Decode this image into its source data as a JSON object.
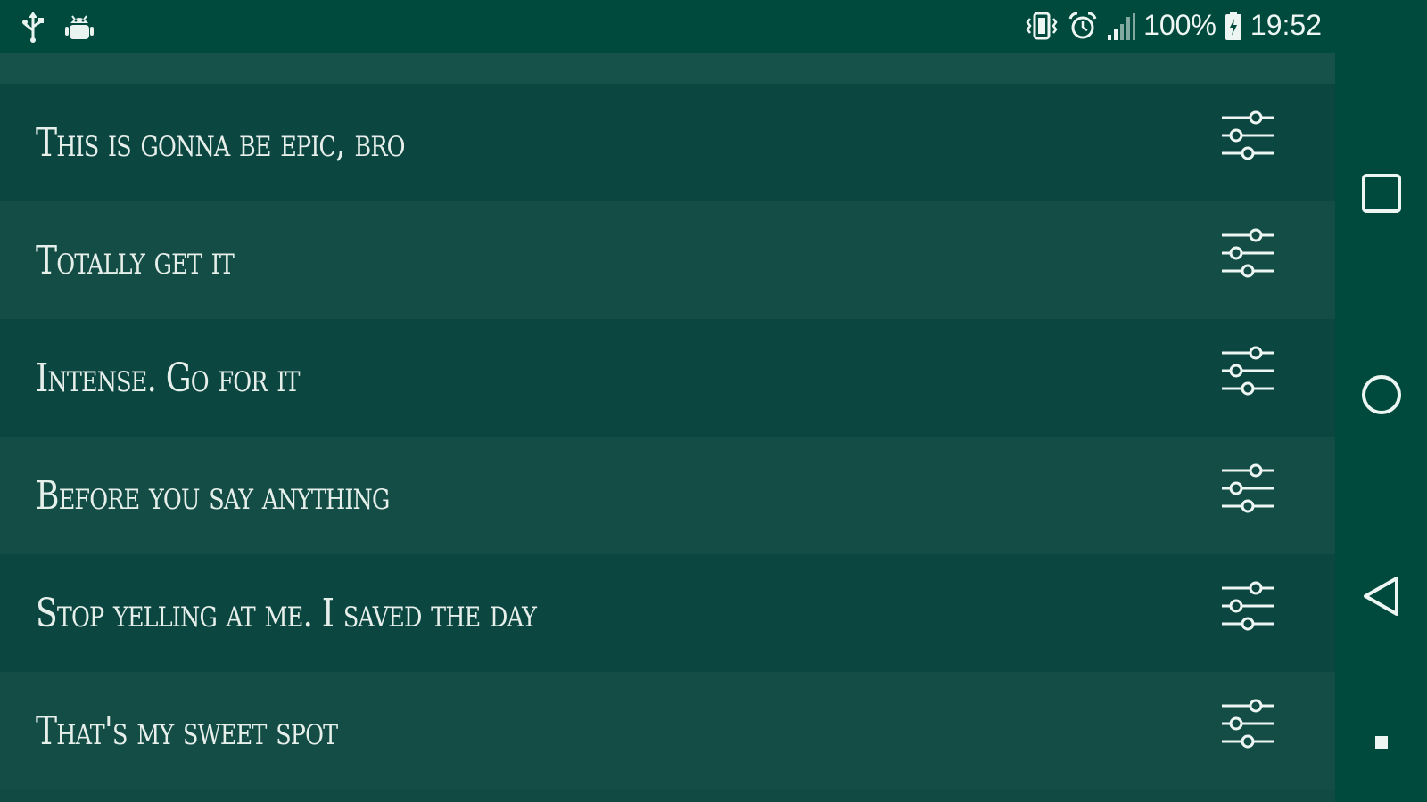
{
  "status_bar": {
    "battery_percent": "100%",
    "time": "19:52",
    "left_icons": [
      "usb-icon",
      "android-debug-icon"
    ],
    "right_icons": [
      "vibrate-icon",
      "alarm-icon",
      "signal-icon",
      "battery-icon"
    ]
  },
  "list": {
    "items": [
      {
        "label": "This is gonna be epic, bro",
        "action_icon": "sliders-icon"
      },
      {
        "label": "Totally get it",
        "action_icon": "sliders-icon"
      },
      {
        "label": "Intense. Go for it",
        "action_icon": "sliders-icon"
      },
      {
        "label": "Before you say anything",
        "action_icon": "sliders-icon"
      },
      {
        "label": "Stop yelling at me. I saved the day",
        "action_icon": "sliders-icon"
      },
      {
        "label": "That's my sweet spot",
        "action_icon": "sliders-icon"
      }
    ]
  },
  "nav_bar": {
    "buttons": [
      "recents-icon",
      "home-icon",
      "back-icon",
      "menu-dot-icon"
    ]
  },
  "colors": {
    "status_bar_bg": "#00493d",
    "row_dark": "#0b4641",
    "row_light": "#134d46",
    "text": "#e7efeb"
  }
}
